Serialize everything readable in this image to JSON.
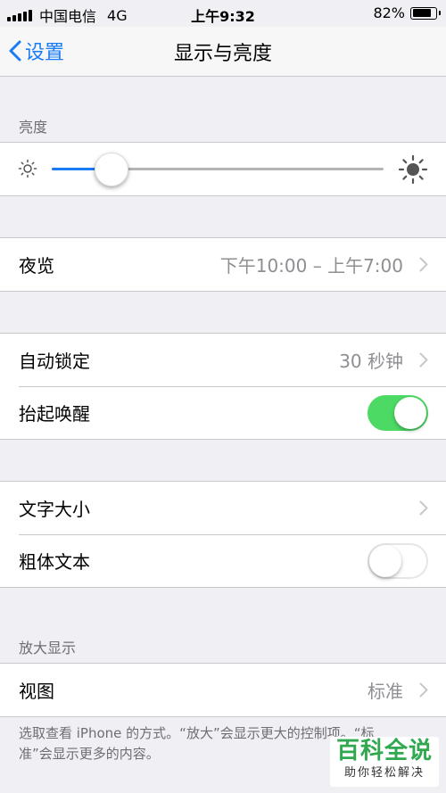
{
  "status_bar": {
    "carrier": "中国电信",
    "network": "4G",
    "time": "上午9:32",
    "battery": "82%",
    "battery_level": 0.82
  },
  "nav": {
    "back_label": "设置",
    "title": "显示与亮度"
  },
  "brightness": {
    "header": "亮度",
    "level": 0.18,
    "accent_color": "#1a7cf5"
  },
  "night_shift": {
    "label": "夜览",
    "value": "下午10:00 – 上午7:00"
  },
  "auto_lock": {
    "label": "自动锁定",
    "value": "30 秒钟"
  },
  "raise_to_wake": {
    "label": "抬起唤醒",
    "on": true,
    "on_color": "#4cd964"
  },
  "text_size": {
    "label": "文字大小"
  },
  "bold_text": {
    "label": "粗体文本",
    "on": false
  },
  "zoom": {
    "header": "放大显示",
    "view_label": "视图",
    "view_value": "标准",
    "footer": "选取查看 iPhone 的方式。“放大”会显示更大的控制项。“标准”会显示更多的内容。"
  },
  "watermark": {
    "title": "百科全说",
    "subtitle": "助你轻松解决"
  },
  "icons": [
    "back-chevron-icon",
    "sun-small-icon",
    "sun-large-icon",
    "chevron-right-icon",
    "signal-icon",
    "battery-icon"
  ]
}
